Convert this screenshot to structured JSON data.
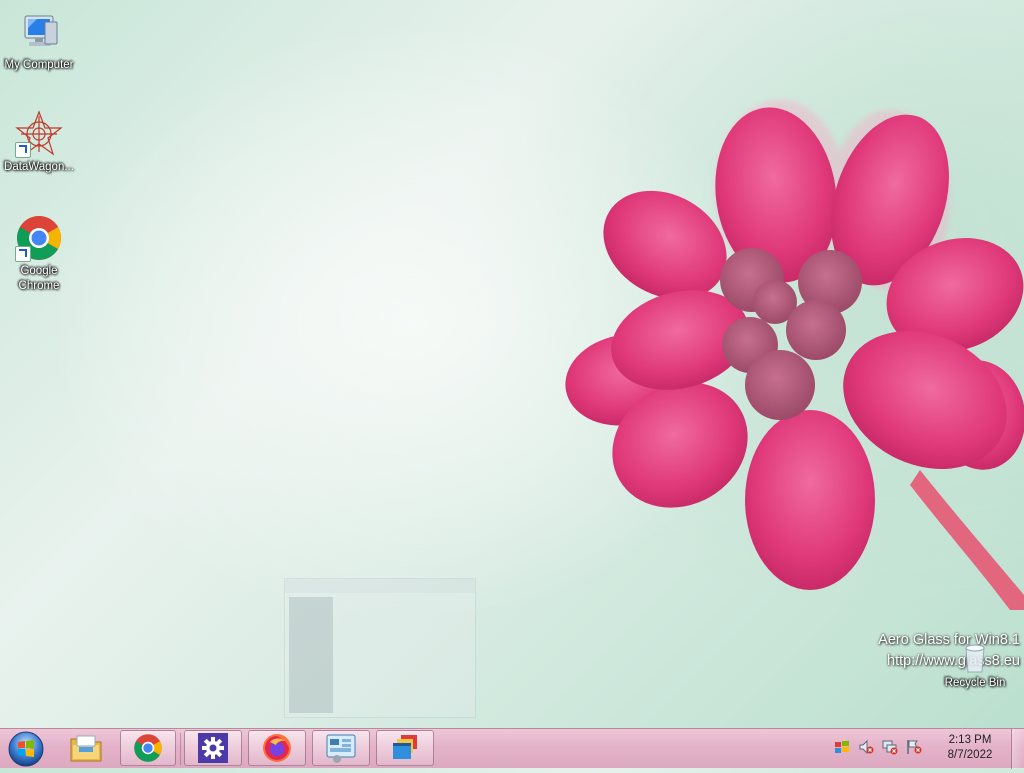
{
  "desktop": {
    "icons": [
      {
        "label": "My Computer",
        "icon": "computer-icon"
      },
      {
        "label": "DataWagon...",
        "icon": "datawagon-icon"
      },
      {
        "label": "Google Chrome",
        "icon": "chrome-icon"
      },
      {
        "label": "Recycle Bin",
        "icon": "recycle-bin-icon"
      }
    ],
    "watermark": {
      "line1": "Aero Glass for Win8.1",
      "line2": "http://www.glass8.eu"
    }
  },
  "taskbar": {
    "start_icon": "windows-start-icon",
    "pinned": [
      {
        "icon": "file-explorer-icon",
        "active": false
      },
      {
        "icon": "chrome-icon",
        "active": true
      },
      {
        "icon": "settings-gear-icon",
        "active": true
      },
      {
        "icon": "firefox-icon",
        "active": true
      },
      {
        "icon": "control-panel-icon",
        "active": true
      },
      {
        "icon": "windows-stack-icon",
        "active": true
      }
    ],
    "tray_icons": [
      "action-center-flag-icon",
      "speaker-muted-icon",
      "network-disconnected-icon",
      "flag-error-icon"
    ],
    "clock": {
      "time": "2:13 PM",
      "date": "8/7/2022"
    }
  },
  "colors": {
    "taskbar": "#e4b3c9",
    "petal": "#e24a86",
    "wallpaper": "#d7ebe2"
  }
}
